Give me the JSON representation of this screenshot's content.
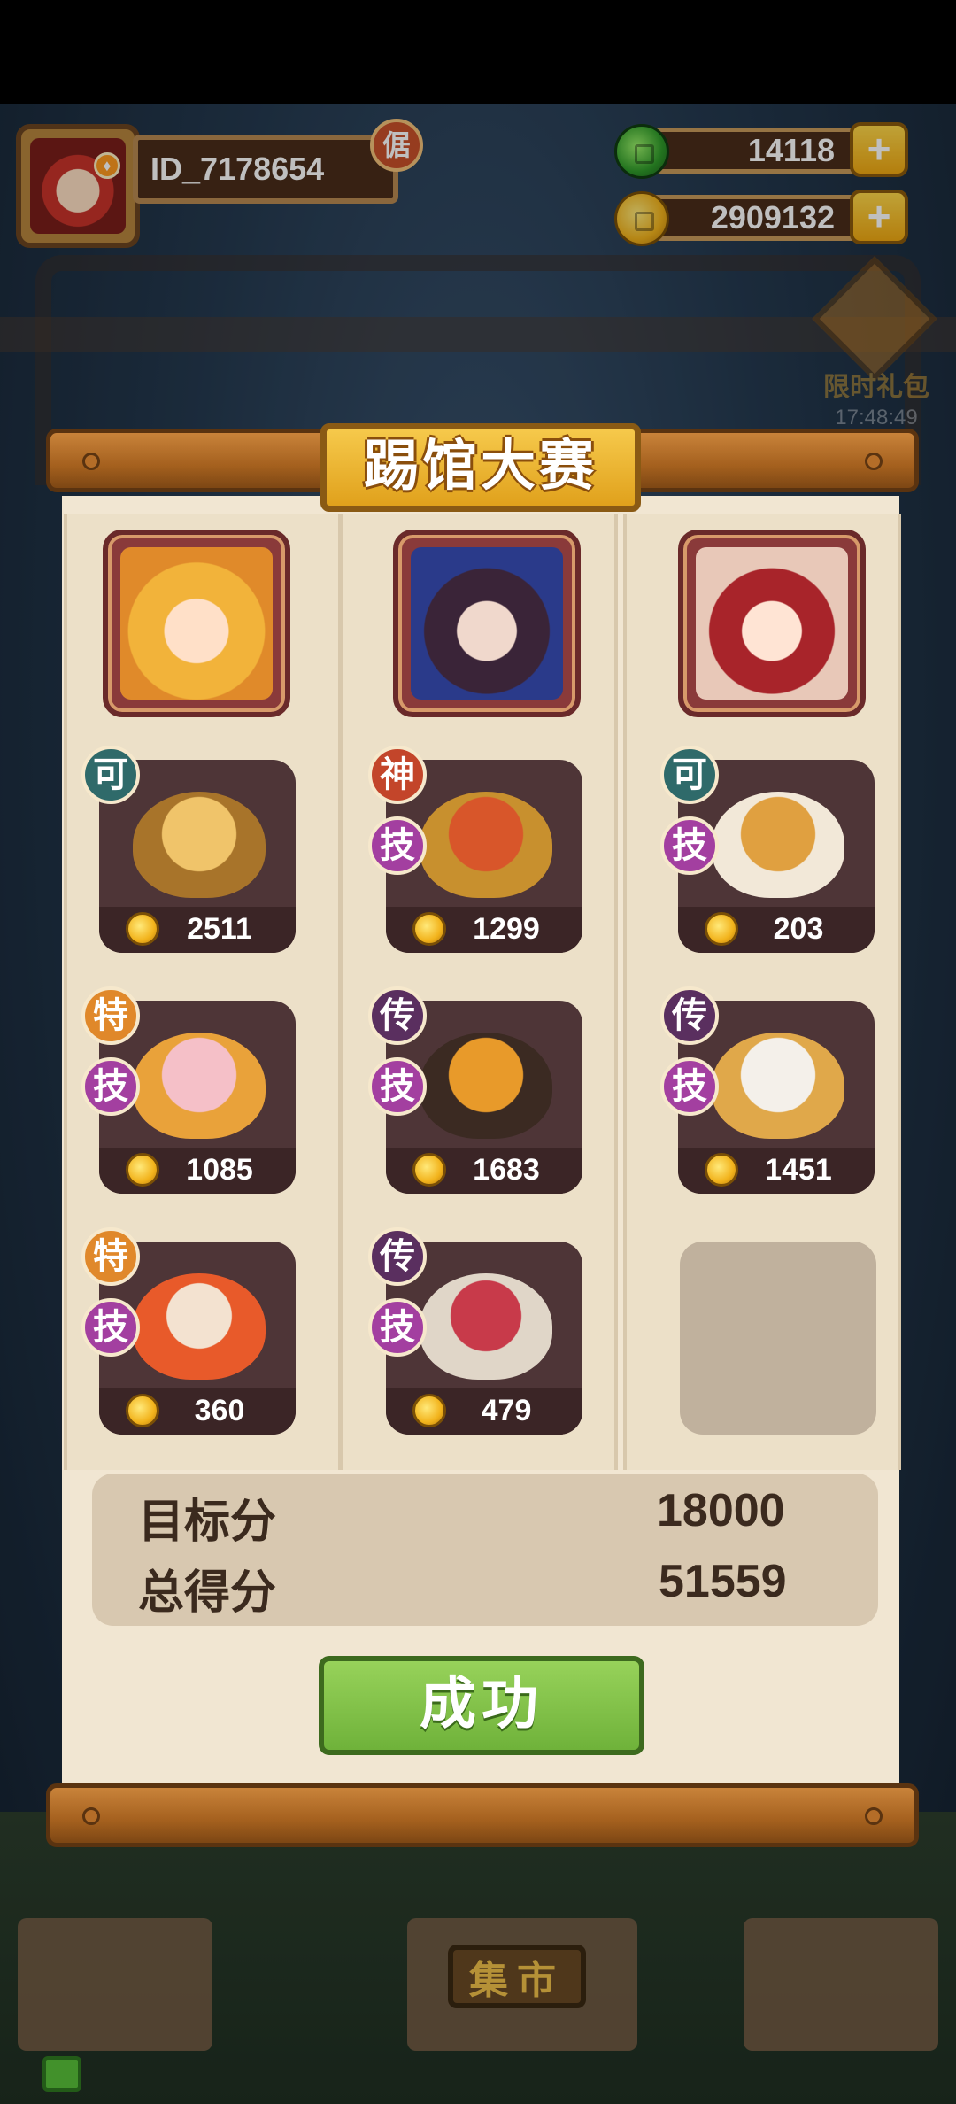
{
  "player": {
    "id": "ID_7178654",
    "rank_badge": "倨"
  },
  "resources": {
    "jade": "14118",
    "coins": "2909132",
    "plus": "+"
  },
  "gift": {
    "label": "限时礼包",
    "timer": "17:48:49"
  },
  "panel": {
    "title": "踢馆大赛",
    "columns": [
      {
        "dishes": [
          {
            "badges": [
              "可"
            ],
            "price": "2511",
            "colors": [
              "#f0c46a",
              "#a8742a"
            ]
          },
          {
            "badges": [
              "特",
              "技"
            ],
            "price": "1085",
            "colors": [
              "#f5c0c8",
              "#e9a23a"
            ]
          },
          {
            "badges": [
              "特",
              "技"
            ],
            "price": "360",
            "colors": [
              "#e85a2a",
              "#f3e2d0"
            ]
          }
        ]
      },
      {
        "dishes": [
          {
            "badges": [
              "神",
              "技"
            ],
            "price": "1299",
            "colors": [
              "#d8562a",
              "#c8902e"
            ]
          },
          {
            "badges": [
              "传",
              "技"
            ],
            "price": "1683",
            "colors": [
              "#3b2a22",
              "#e89a2a"
            ]
          },
          {
            "badges": [
              "传",
              "技"
            ],
            "price": "479",
            "colors": [
              "#c83a4a",
              "#e0d6c8"
            ]
          }
        ]
      },
      {
        "dishes": [
          {
            "badges": [
              "可",
              "技"
            ],
            "price": "203",
            "colors": [
              "#e0a040",
              "#f2e8d8"
            ]
          },
          {
            "badges": [
              "传",
              "技"
            ],
            "price": "1451",
            "colors": [
              "#f4f0ea",
              "#e0a84a"
            ]
          }
        ]
      }
    ]
  },
  "scores": {
    "target_label": "目标分",
    "target_value": "18000",
    "total_label": "总得分",
    "total_value": "51559"
  },
  "result_button": "成功",
  "market_sign": "集市",
  "colors": {
    "panel_bg": "#f1e6d2",
    "card_bg": "#4e3537",
    "button_green": "#7fc24a",
    "title_gold": "#f0b52a"
  }
}
